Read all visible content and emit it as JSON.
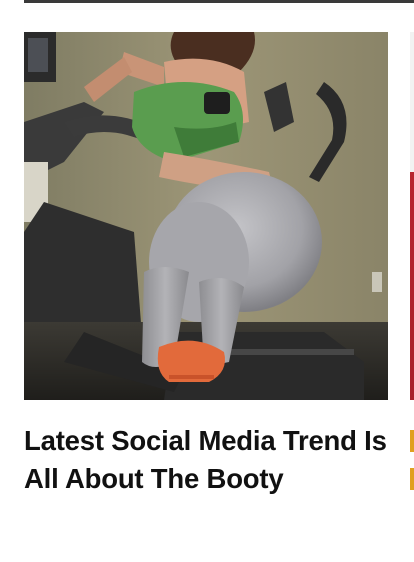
{
  "card": {
    "title": "Latest Social Media Trend Is All About The Booty",
    "image_alt": "woman-on-elliptical-trainer-photo"
  }
}
